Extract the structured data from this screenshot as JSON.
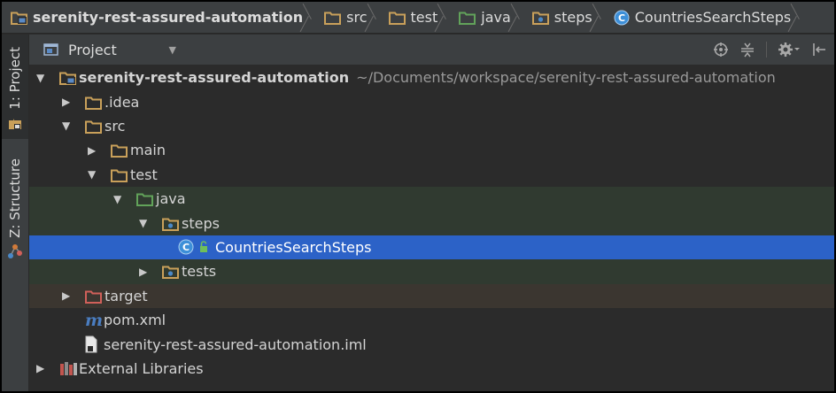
{
  "breadcrumbs": [
    {
      "label": "serenity-rest-assured-automation",
      "icon": "module-folder-icon"
    },
    {
      "label": "src",
      "icon": "folder-icon"
    },
    {
      "label": "test",
      "icon": "folder-icon"
    },
    {
      "label": "java",
      "icon": "test-source-folder-icon"
    },
    {
      "label": "steps",
      "icon": "package-icon"
    },
    {
      "label": "CountriesSearchSteps",
      "icon": "class-icon"
    }
  ],
  "tool_windows": {
    "project": "1: Project",
    "structure": "Z: Structure"
  },
  "panel": {
    "title": "Project",
    "tools": [
      "locate-icon",
      "collapse-all-icon",
      "settings-icon",
      "hide-icon"
    ]
  },
  "tree": [
    {
      "label": "serenity-rest-assured-automation",
      "path": "~/Documents/workspace/serenity-rest-assured-automation",
      "level": 0,
      "state": "expanded",
      "icon": "module-folder-icon",
      "bold": true
    },
    {
      "label": ".idea",
      "level": 1,
      "state": "collapsed",
      "icon": "folder-icon"
    },
    {
      "label": "src",
      "level": 1,
      "state": "expanded",
      "icon": "folder-icon"
    },
    {
      "label": "main",
      "level": 2,
      "state": "collapsed",
      "icon": "folder-icon"
    },
    {
      "label": "test",
      "level": 2,
      "state": "expanded",
      "icon": "folder-icon"
    },
    {
      "label": "java",
      "level": 3,
      "state": "expanded",
      "icon": "test-source-folder-icon",
      "bg": "green"
    },
    {
      "label": "steps",
      "level": 4,
      "state": "expanded",
      "icon": "package-icon",
      "bg": "green"
    },
    {
      "label": "CountriesSearchSteps",
      "level": 5,
      "state": "leaf",
      "icon": "class-icon",
      "selected": true
    },
    {
      "label": "tests",
      "level": 4,
      "state": "collapsed",
      "icon": "package-icon",
      "bg": "green"
    },
    {
      "label": "target",
      "level": 1,
      "state": "collapsed",
      "icon": "excluded-folder-icon",
      "bg": "brown"
    },
    {
      "label": "pom.xml",
      "level": 1,
      "state": "leaf",
      "icon": "maven-icon"
    },
    {
      "label": "serenity-rest-assured-automation.iml",
      "level": 1,
      "state": "leaf",
      "icon": "iml-file-icon"
    },
    {
      "label": "External Libraries",
      "level": 0,
      "state": "collapsed",
      "icon": "libraries-icon"
    }
  ],
  "colors": {
    "folder": "#c9a05a",
    "test_folder": "#62a35a",
    "excluded_folder": "#d0605a",
    "package_dot": "#4a88c7",
    "class_circle": "#3d8fd8",
    "selection": "#2c62c7",
    "maven": "#4a7dc0"
  }
}
